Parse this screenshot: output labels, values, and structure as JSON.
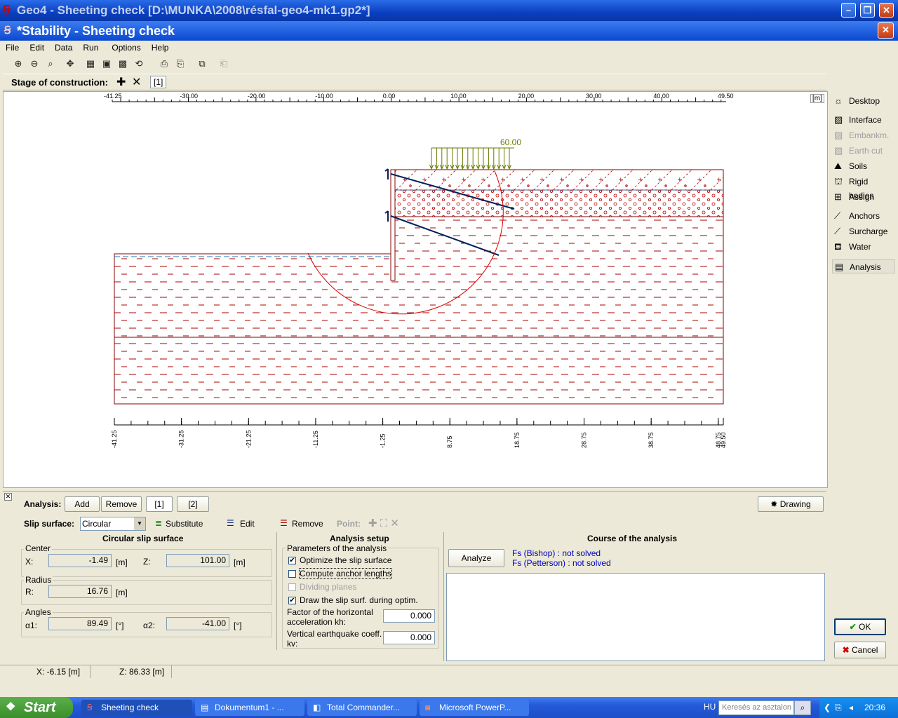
{
  "window": {
    "title": "Geo4 - Sheeting check [D:\\MUNKA\\2008\\résfal-geo4-mk1.gp2*]",
    "subtitle": "*Stability - Sheeting check"
  },
  "menu": [
    "File",
    "Edit",
    "Data",
    "Run",
    "Options",
    "Help"
  ],
  "stage": {
    "label": "Stage of construction:",
    "tab": "[1]"
  },
  "ruler": {
    "unit": "[m]",
    "ticks": [
      "-41.25",
      "-30.00",
      "-20.00",
      "-10.00",
      "0.00",
      "10.00",
      "20.00",
      "30.00",
      "40.00",
      "49.50"
    ]
  },
  "bottom_ruler": {
    "ticks": [
      "-41.25",
      "-31.25",
      "-21.25",
      "-11.25",
      "-1.25",
      "8.75",
      "18.75",
      "28.75",
      "38.75",
      "48.75",
      "49.50"
    ]
  },
  "load_label": "60.00",
  "right_panel": [
    {
      "label": "Desktop",
      "icon": "desktop-icon",
      "enabled": true
    },
    {
      "label": "Interface",
      "icon": "interface-icon",
      "enabled": true
    },
    {
      "label": "Embankm.",
      "icon": "embankment-icon",
      "enabled": false
    },
    {
      "label": "Earth cut",
      "icon": "earth-cut-icon",
      "enabled": false
    },
    {
      "label": "Soils",
      "icon": "soils-icon",
      "enabled": true
    },
    {
      "label": "Rigid bodies",
      "icon": "rigid-bodies-icon",
      "enabled": true
    },
    {
      "label": "Assign",
      "icon": "assign-icon",
      "enabled": true
    },
    {
      "label": "Anchors",
      "icon": "anchors-icon",
      "enabled": true
    },
    {
      "label": "Surcharge",
      "icon": "surcharge-icon",
      "enabled": true
    },
    {
      "label": "Water",
      "icon": "water-icon",
      "enabled": true
    },
    {
      "label": "Analysis",
      "icon": "analysis-icon",
      "enabled": true
    }
  ],
  "analysis": {
    "label": "Analysis:",
    "add": "Add",
    "remove": "Remove",
    "tabs": [
      "[1]",
      "[2]"
    ],
    "drawing": "Drawing"
  },
  "slip": {
    "label": "Slip surface:",
    "value": "Circular",
    "substitute": "Substitute",
    "edit": "Edit",
    "remove": "Remove",
    "point": "Point:"
  },
  "circular": {
    "title": "Circular slip surface",
    "center": "Center",
    "x_label": "X:",
    "x_value": "-1.49",
    "z_label": "Z:",
    "z_value": "101.00",
    "unit_m": "[m]",
    "radius": "Radius",
    "r_label": "R:",
    "r_value": "16.76",
    "angles": "Angles",
    "a1_label": "α1:",
    "a1_value": "89.49",
    "a2_label": "α2:",
    "a2_value": "-41.00",
    "unit_deg": "[°]"
  },
  "setup": {
    "title": "Analysis setup",
    "params": "Parameters of the analysis",
    "optimize": "Optimize the slip surface",
    "compute": "Compute anchor lengths",
    "dividing": "Dividing planes",
    "draw": "Draw the slip surf. during optim.",
    "kh_label": "Factor of the horizontal acceleration kh:",
    "kh_value": "0.000",
    "kv_label": "Vertical earthquake coeff. kv:",
    "kv_value": "0.000",
    "optimize_checked": true,
    "compute_checked": false,
    "dividing_checked": false,
    "draw_checked": true
  },
  "course": {
    "title": "Course of the analysis",
    "analyze": "Analyze",
    "bishop": "Fs (Bishop) : not solved",
    "petterson": "Fs (Petterson) : not solved",
    "accent": "#0000c0"
  },
  "buttons": {
    "ok": "OK",
    "cancel": "Cancel"
  },
  "status": {
    "x": "X: -6.15 [m]",
    "z": "Z: 86.33 [m]"
  },
  "taskbar": {
    "start": "Start",
    "tasks": [
      "Sheeting check",
      "Dokumentum1 - ...",
      "Total Commander...",
      "Microsoft PowerP..."
    ],
    "lang": "HU",
    "search": "Keresés az asztalon",
    "time": "20:36"
  }
}
